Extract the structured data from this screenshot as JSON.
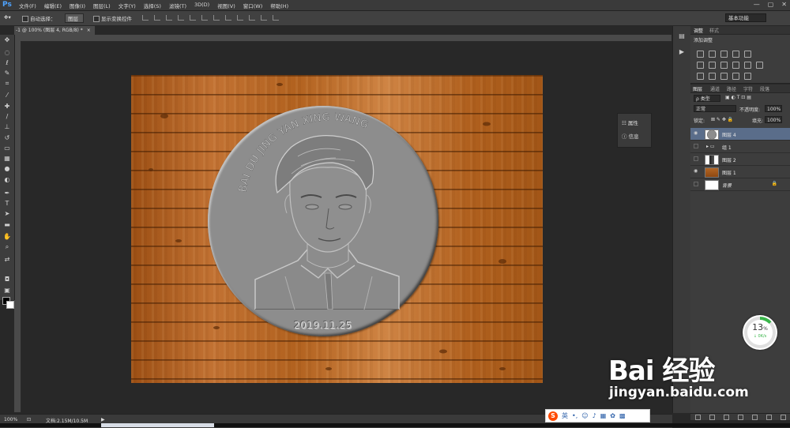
{
  "app": {
    "logo": "Ps",
    "menus": [
      "文件(F)",
      "编辑(E)",
      "图像(I)",
      "图层(L)",
      "文字(Y)",
      "选择(S)",
      "滤镜(T)",
      "3D(D)",
      "视图(V)",
      "窗口(W)",
      "帮助(H)"
    ],
    "window_controls": [
      "—",
      "▢",
      "✕"
    ]
  },
  "options_bar": {
    "auto_select_label": "自动选择：",
    "auto_select_value": "图层",
    "show_transform_label": "显示变换控件",
    "workspace": "基本功能"
  },
  "document": {
    "tab_label": "-1 @ 100% (图层 4, RGB/8) *",
    "zoom": "100%",
    "doc_size": "文档:2.15M/10.5M"
  },
  "canvas": {
    "coin_arc_text": "BAI DU JING YAN XING WANG",
    "coin_date": "2019.11.25"
  },
  "mini_panel": {
    "items": [
      {
        "icon": "properties-icon",
        "label": "属性"
      },
      {
        "icon": "info-icon",
        "label": "信息"
      }
    ]
  },
  "adjustments_panel": {
    "tabs": [
      "调整",
      "样式"
    ],
    "heading": "添加调整"
  },
  "layers_panel": {
    "tabs": [
      "图层",
      "通道",
      "路径",
      "字符",
      "段落"
    ],
    "filter_kind": "ρ 类型",
    "blend_mode": "正常",
    "opacity_label": "不透明度:",
    "opacity_value": "100%",
    "lock_label": "锁定:",
    "fill_label": "填充:",
    "fill_value": "100%",
    "layers": [
      {
        "name": "图层 4",
        "visible": true,
        "selected": true,
        "thumb": "coin"
      },
      {
        "name": "组 1",
        "visible": false,
        "selected": false,
        "thumb": "folder"
      },
      {
        "name": "图层 2",
        "visible": false,
        "selected": false,
        "thumb": "portrait"
      },
      {
        "name": "图层 1",
        "visible": true,
        "selected": false,
        "thumb": "wood"
      },
      {
        "name": "背景",
        "visible": false,
        "selected": false,
        "thumb": "white",
        "locked": true
      }
    ]
  },
  "progress_widget": {
    "percent": 13,
    "percent_text": "13",
    "percent_unit": "%",
    "speed": "0K/s"
  },
  "watermark": {
    "logo": "Bai 经验",
    "url": "jingyan.baidu.com"
  },
  "ime_bar": {
    "logo": "S",
    "mode": "英"
  },
  "colors": {
    "accent": "#4ea3ff",
    "selected_layer": "#5a6d8a",
    "progress_green": "#39b54a",
    "ime_orange": "#ff4a00"
  }
}
